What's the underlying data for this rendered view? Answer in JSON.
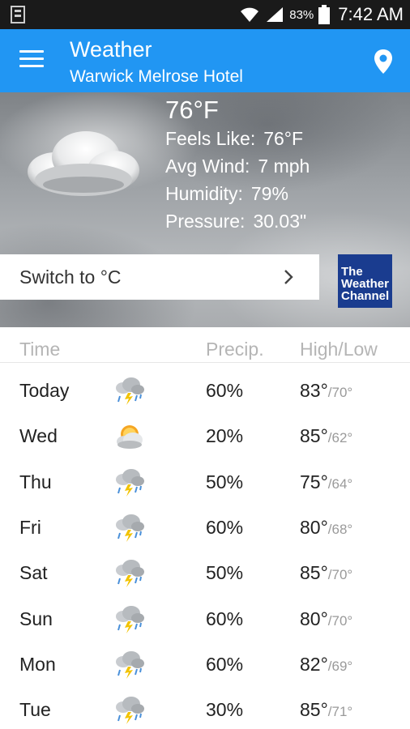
{
  "status_bar": {
    "battery_percent": "83%",
    "time": "7:42 AM",
    "icons": [
      "notification-icon",
      "wifi-icon",
      "signal-icon",
      "battery-icon"
    ]
  },
  "app_bar": {
    "title": "Weather",
    "subtitle": "Warwick Melrose Hotel",
    "menu_icon": "hamburger-menu-icon",
    "location_icon": "location-pin-icon",
    "background_color": "#2196f3"
  },
  "current": {
    "temperature": "76°F",
    "conditions": [
      {
        "label": "Feels Like:",
        "value": "76°F"
      },
      {
        "label": "Avg Wind:",
        "value": "7 mph"
      },
      {
        "label": "Humidity:",
        "value": "79%"
      },
      {
        "label": "Pressure:",
        "value": "30.03\""
      }
    ],
    "condition_icon": "cloudy-icon"
  },
  "switch_units": {
    "label": "Switch to °C"
  },
  "brand_logo": {
    "lines": [
      "The",
      "Weather",
      "Channel"
    ],
    "color": "#1a3c8f"
  },
  "forecast": {
    "headers": {
      "time": "Time",
      "precip": "Precip.",
      "high_low": "High/Low"
    },
    "rows": [
      {
        "day": "Today",
        "icon": "thunderstorm-icon",
        "precip": "60%",
        "high": "83°",
        "low": "/70°"
      },
      {
        "day": "Wed",
        "icon": "partly-cloudy-icon",
        "precip": "20%",
        "high": "85°",
        "low": "/62°"
      },
      {
        "day": "Thu",
        "icon": "thunderstorm-icon",
        "precip": "50%",
        "high": "75°",
        "low": "/64°"
      },
      {
        "day": "Fri",
        "icon": "thunderstorm-icon",
        "precip": "60%",
        "high": "80°",
        "low": "/68°"
      },
      {
        "day": "Sat",
        "icon": "thunderstorm-icon",
        "precip": "50%",
        "high": "85°",
        "low": "/70°"
      },
      {
        "day": "Sun",
        "icon": "thunderstorm-icon",
        "precip": "60%",
        "high": "80°",
        "low": "/70°"
      },
      {
        "day": "Mon",
        "icon": "thunderstorm-icon",
        "precip": "60%",
        "high": "82°",
        "low": "/69°"
      },
      {
        "day": "Tue",
        "icon": "thunderstorm-icon",
        "precip": "30%",
        "high": "85°",
        "low": "/71°"
      }
    ]
  }
}
